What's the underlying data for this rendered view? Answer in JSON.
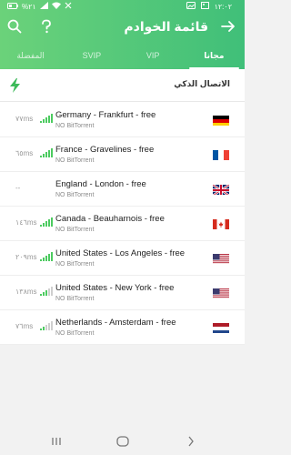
{
  "status_bar": {
    "time": "١٢:٠٢",
    "battery": "%٢١"
  },
  "header": {
    "title": "قائمة الخوادم",
    "back_icon": "arrow-right-icon",
    "help_icon": "question-mark-icon",
    "search_icon": "search-icon"
  },
  "tabs": [
    {
      "label": "مجانا",
      "active": true
    },
    {
      "label": "VIP",
      "active": false
    },
    {
      "label": "SVIP",
      "active": false
    },
    {
      "label": "المفضلة",
      "active": false
    }
  ],
  "smart_connect": {
    "label": "الاتصال الذكي",
    "icon": "lightning-bolt-icon"
  },
  "servers": [
    {
      "name": "Germany - Frankfurt - free",
      "note": "NO BitTorrent",
      "latency": "٧٧ms",
      "signal_bars": 5,
      "flag": "de"
    },
    {
      "name": "France - Gravelines - free",
      "note": "NO BitTorrent",
      "latency": "٦٥ms",
      "signal_bars": 5,
      "flag": "fr"
    },
    {
      "name": "England - London - free",
      "note": "NO BitTorrent",
      "latency": "--",
      "signal_bars": 0,
      "flag": "gb"
    },
    {
      "name": "Canada - Beauharnois - free",
      "note": "NO BitTorrent",
      "latency": "١٤٦ms",
      "signal_bars": 5,
      "flag": "ca"
    },
    {
      "name": "United States - Los Angeles - free",
      "note": "NO BitTorrent",
      "latency": "٢٠٩ms",
      "signal_bars": 5,
      "flag": "us"
    },
    {
      "name": "United States - New York - free",
      "note": "NO BitTorrent",
      "latency": "١٣٨ms",
      "signal_bars": 3,
      "flag": "us"
    },
    {
      "name": "Netherlands - Amsterdam - free",
      "note": "NO BitTorrent",
      "latency": "٧٦ms",
      "signal_bars": 2,
      "flag": "nl"
    }
  ],
  "colors": {
    "header_start": "#6bd27a",
    "header_end": "#40bf79",
    "signal_on": "#4ccb60",
    "signal_off": "#cfcfcf"
  }
}
